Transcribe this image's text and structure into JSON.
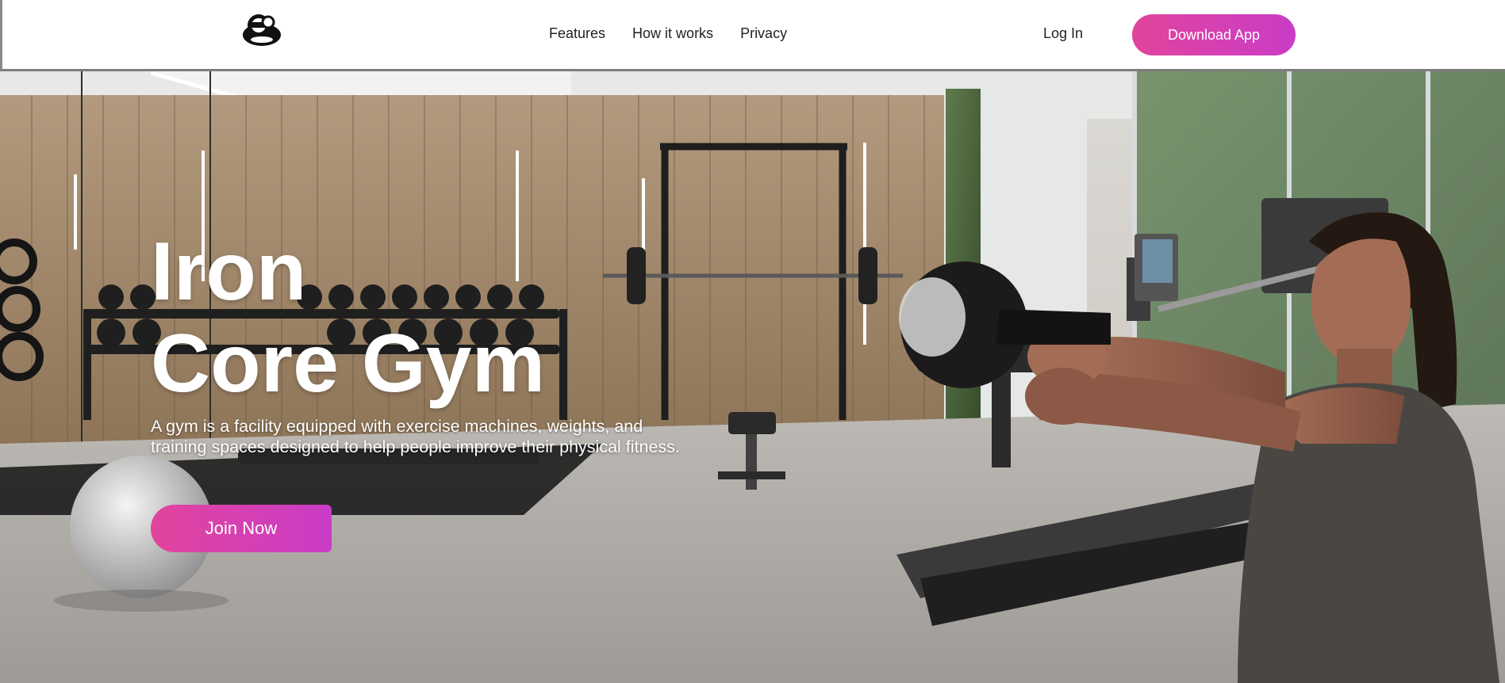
{
  "nav": {
    "logo_icon": "gym-kettlebell-logo-icon",
    "links": [
      {
        "label": "Features"
      },
      {
        "label": "How it works"
      },
      {
        "label": "Privacy"
      }
    ],
    "login_label": "Log In",
    "download_label": "Download App"
  },
  "hero": {
    "title_line1": "Iron",
    "title_line2": "Core Gym",
    "description": "A gym is a facility equipped with exercise machines, weights, and training spaces designed to help people improve their physical fitness.",
    "cta_label": "Join Now",
    "background_image": "home-gym-interior-photo",
    "foreground_image": "woman-swinging-kettlebell-photo"
  },
  "colors": {
    "accent_start": "#e2449c",
    "accent_end": "#c93cc7",
    "nav_text": "#222222"
  }
}
